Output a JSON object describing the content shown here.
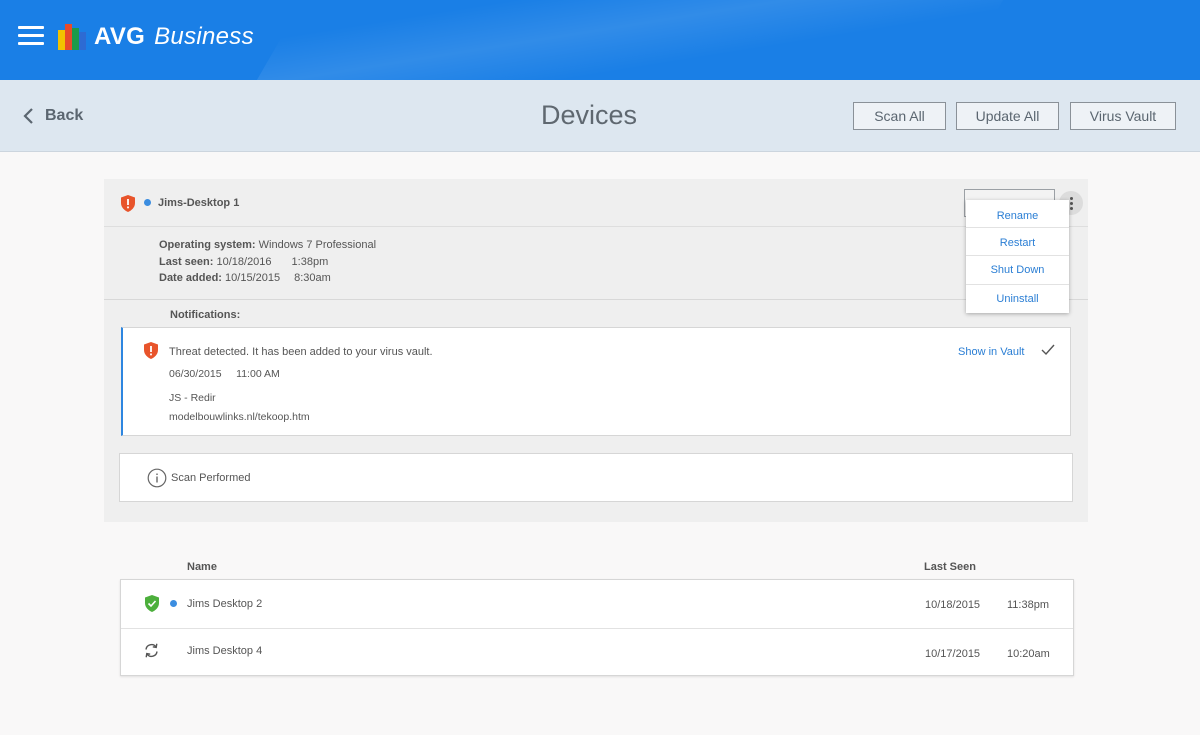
{
  "app": {
    "brand_name": "AVG",
    "brand_suffix": "Business"
  },
  "header": {
    "back_label": "Back",
    "title": "Devices",
    "buttons": [
      "Scan All",
      "Update All",
      "Virus Vault"
    ]
  },
  "device": {
    "name": "Jims-Desktop 1",
    "os_label": "Operating system:",
    "os": "Windows 7 Professional",
    "last_seen_label": "Last seen:",
    "last_seen_date": "10/18/2016",
    "last_seen_time": "1:38pm",
    "date_added_label": "Date added:",
    "date_added_date": "10/15/2015",
    "date_added_time": "8:30am",
    "notifications_label": "Notifications:"
  },
  "threat": {
    "title": "Threat detected. It has been added to your virus vault.",
    "date": "06/30/2015",
    "time": "11:00 AM",
    "name": "JS - Redir",
    "url": "modelbouwlinks.nl/tekoop.htm",
    "action": "Show in Vault"
  },
  "scan": {
    "label": "Scan Performed"
  },
  "menu": {
    "items": [
      "Rename",
      "Restart",
      "Shut Down",
      "Uninstall"
    ]
  },
  "table": {
    "columns": {
      "name": "Name",
      "last_seen": "Last Seen"
    },
    "rows": [
      {
        "name": "Jims Desktop 2",
        "date": "10/18/2015",
        "time": "11:38pm",
        "status_icon": "shield-check-icon",
        "online": true
      },
      {
        "name": "Jims Desktop 4",
        "date": "10/17/2015",
        "time": "10:20am",
        "status_icon": "sync-icon",
        "online": false
      }
    ]
  },
  "colors": {
    "topbar": "#1a7fe6",
    "subbar": "#dde7f0",
    "link": "#2a7ed4",
    "threat_red": "#e8542b",
    "safe_green": "#4caf3c",
    "online_dot": "#3b8de0"
  }
}
